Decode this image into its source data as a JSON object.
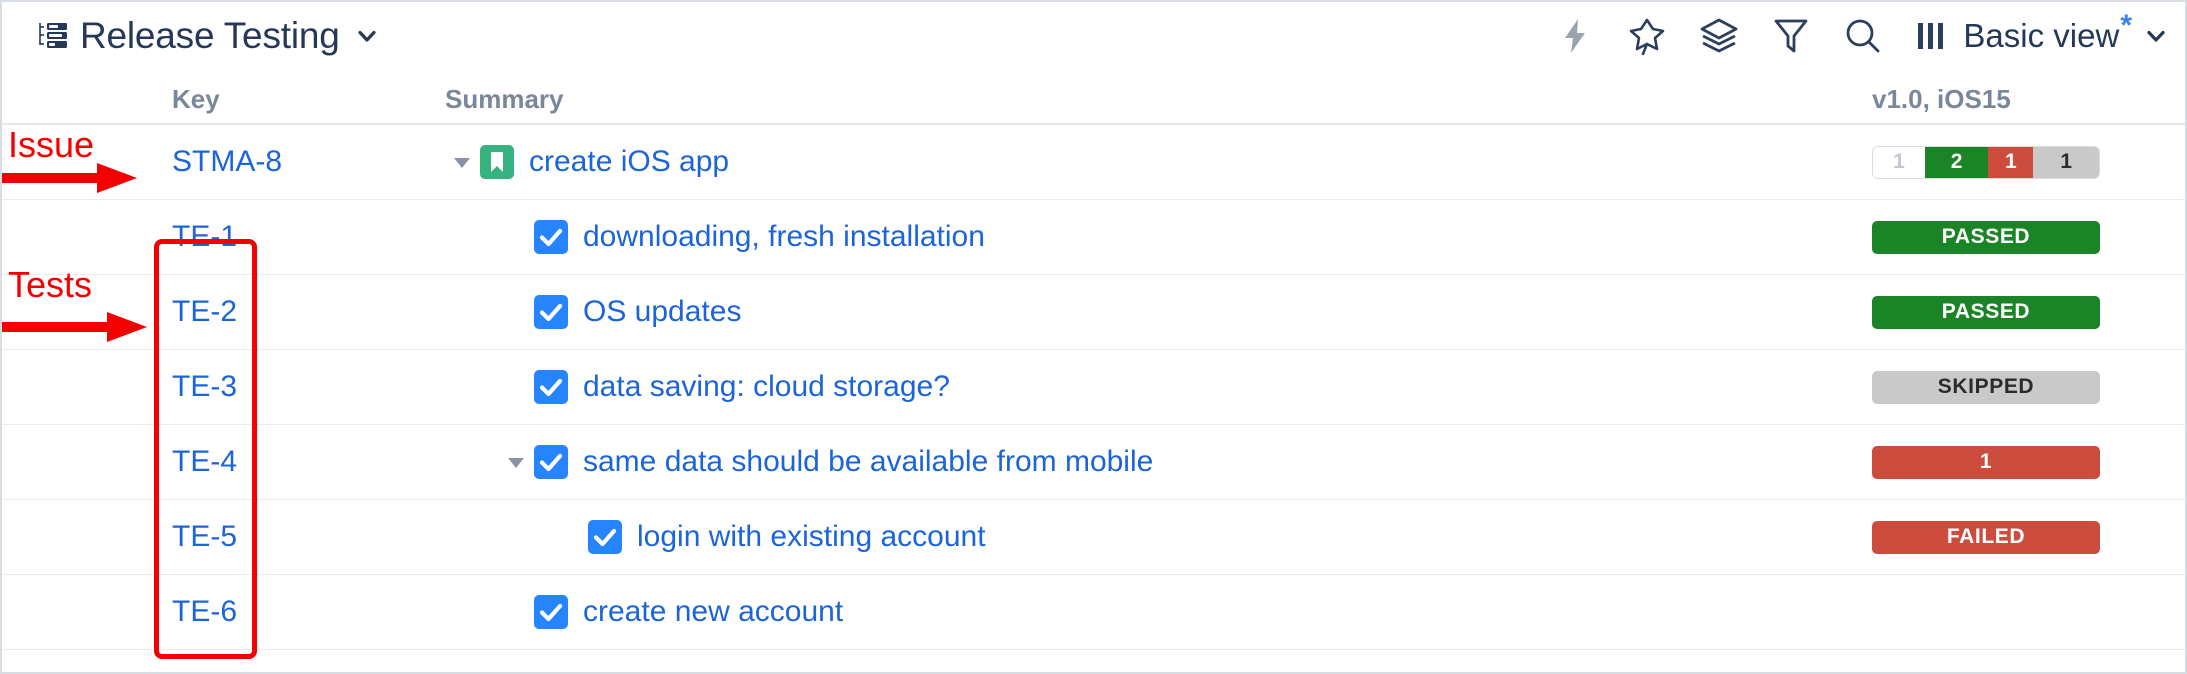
{
  "header": {
    "title": "Release Testing",
    "structure_icon": "structure-icon",
    "title_chevron_icon": "chevron-down-icon",
    "toolbar": [
      {
        "name": "automation-lightning-icon",
        "label": "Automation"
      },
      {
        "name": "pin-icon",
        "label": "Pin"
      },
      {
        "name": "layers-icon",
        "label": "Layers"
      },
      {
        "name": "filter-icon",
        "label": "Filter"
      },
      {
        "name": "search-icon",
        "label": "Search"
      }
    ],
    "view": {
      "columns_icon": "columns-icon",
      "label": "Basic view",
      "modified_marker": "*",
      "chevron_icon": "chevron-down-icon"
    }
  },
  "columns": {
    "key": "Key",
    "summary": "Summary",
    "status": "v1.0, iOS15"
  },
  "rows": [
    {
      "key": "STMA-8",
      "summary": "create iOS app",
      "type": "issue",
      "type_icon": "story-bookmark-icon",
      "indent": 0,
      "expander": "expanded",
      "status_kind": "aggregate"
    },
    {
      "key": "TE-1",
      "summary": "downloading, fresh installation",
      "type": "test",
      "type_icon": "test-checkbox-icon",
      "indent": 1,
      "expander": "none",
      "status_kind": "badge",
      "status_label": "PASSED",
      "status_class": "passed"
    },
    {
      "key": "TE-2",
      "summary": "OS updates",
      "type": "test",
      "type_icon": "test-checkbox-icon",
      "indent": 1,
      "expander": "none",
      "status_kind": "badge",
      "status_label": "PASSED",
      "status_class": "passed"
    },
    {
      "key": "TE-3",
      "summary": "data saving: cloud storage?",
      "type": "test",
      "type_icon": "test-checkbox-icon",
      "indent": 1,
      "expander": "none",
      "status_kind": "badge",
      "status_label": "SKIPPED",
      "status_class": "skipped"
    },
    {
      "key": "TE-4",
      "summary": "same data should be available from mobile",
      "type": "test",
      "type_icon": "test-checkbox-icon",
      "indent": 1,
      "expander": "expanded",
      "status_kind": "badge",
      "status_label": "1",
      "status_class": "count"
    },
    {
      "key": "TE-5",
      "summary": "login with existing account",
      "type": "test",
      "type_icon": "test-checkbox-icon",
      "indent": 2,
      "expander": "none",
      "status_kind": "badge",
      "status_label": "FAILED",
      "status_class": "failed"
    },
    {
      "key": "TE-6",
      "summary": "create new account",
      "type": "test",
      "type_icon": "test-checkbox-icon",
      "indent": 1,
      "expander": "none",
      "status_kind": "badge",
      "status_label": "",
      "status_class": "none"
    }
  ],
  "aggregate": {
    "segments": [
      {
        "label": "1",
        "class": "todo",
        "width_pct": 23
      },
      {
        "label": "2",
        "class": "pass",
        "width_pct": 28
      },
      {
        "label": "1",
        "class": "fail",
        "width_pct": 20
      },
      {
        "label": "1",
        "class": "skip",
        "width_pct": 29
      }
    ]
  },
  "annotations": {
    "issue_label": "Issue",
    "tests_label": "Tests",
    "color": "#f40000"
  },
  "colors": {
    "link": "#1b64da",
    "title": "#253858",
    "header_text": "#7a869a",
    "passed": "#1b8426",
    "failed": "#cc4c3d",
    "skipped": "#c9c9c9",
    "checkbox_blue": "#2684ff",
    "story_green": "#36b37e"
  }
}
